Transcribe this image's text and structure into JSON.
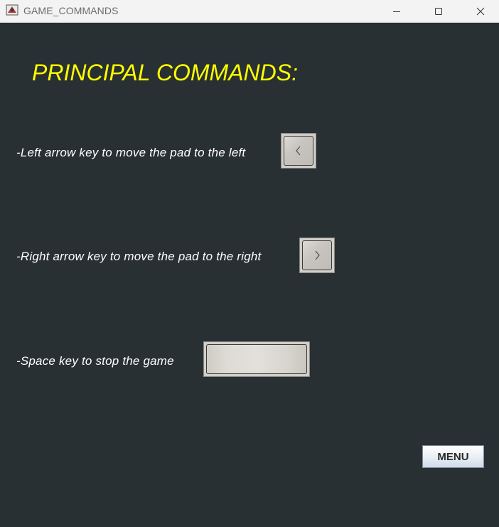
{
  "window": {
    "title": "GAME_COMMANDS",
    "icon": "java-app-icon",
    "controls": [
      "minimize-icon",
      "maximize-icon",
      "close-icon"
    ]
  },
  "heading": "PRINCIPAL COMMANDS:",
  "commands": [
    {
      "text": "-Left arrow key to move the pad to the left",
      "key_icon": "left-arrow-key-icon"
    },
    {
      "text": "-Right arrow key to move the pad to the right",
      "key_icon": "right-arrow-key-icon"
    },
    {
      "text": "-Space key to stop the game",
      "key_icon": "space-key-icon"
    }
  ],
  "menu_button": "MENU",
  "colors": {
    "background": "#293033",
    "heading": "#ffff00",
    "text": "#ffffff"
  }
}
